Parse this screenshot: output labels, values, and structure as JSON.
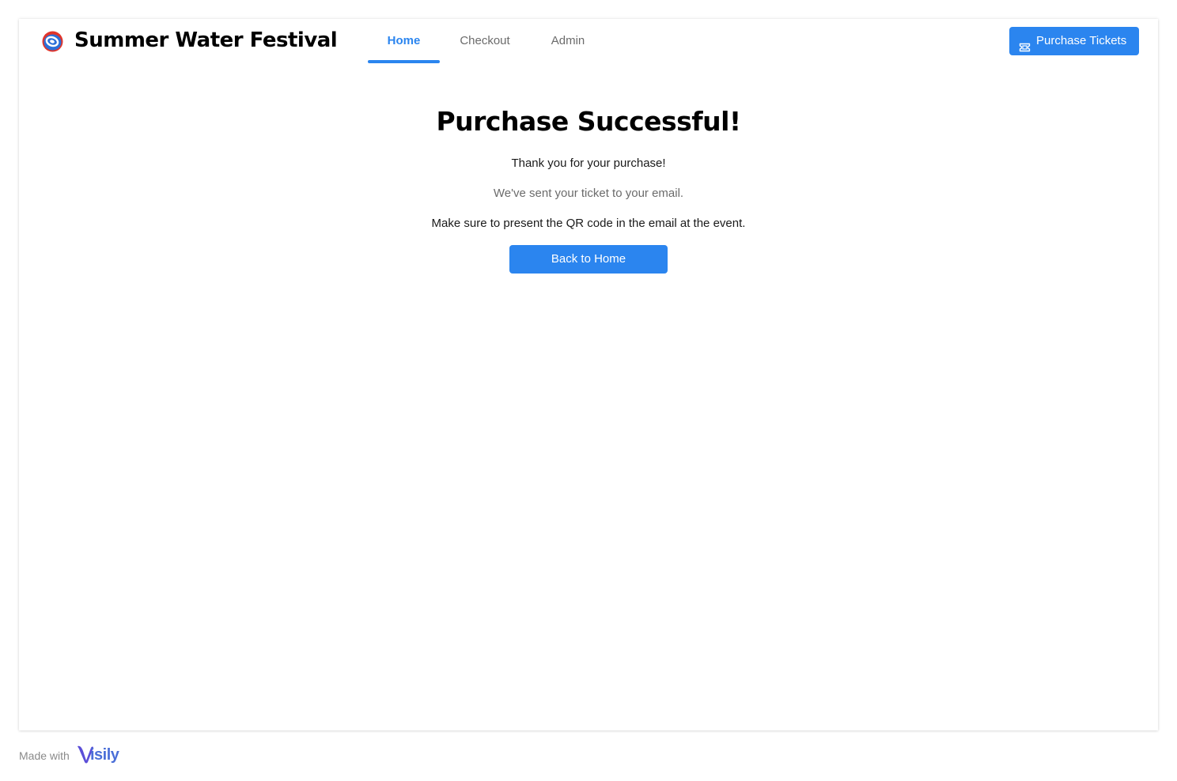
{
  "header": {
    "brand": "Summer Water Festival",
    "logo_icon": "festival-swirl-logo-icon",
    "nav": [
      {
        "label": "Home",
        "active": true
      },
      {
        "label": "Checkout",
        "active": false
      },
      {
        "label": "Admin",
        "active": false
      }
    ],
    "cta_label": "Purchase Tickets",
    "cta_icon": "ticket-icon"
  },
  "main": {
    "title": "Purchase Successful!",
    "thank_you": "Thank you for your purchase!",
    "email_note": "We've sent your ticket to your email.",
    "qr_note": "Make sure to present the QR code in the email at the event.",
    "back_button": "Back to Home"
  },
  "footer": {
    "made_with": "Made with",
    "brand_word": "isily",
    "brand_icon": "visily-v-logo-icon"
  },
  "colors": {
    "accent": "#2b85ef",
    "text": "#000000",
    "muted": "#6b6b6b",
    "logo_red": "#e0342b",
    "logo_blue": "#2b6fd8",
    "visily_blue": "#4b6fd8"
  }
}
